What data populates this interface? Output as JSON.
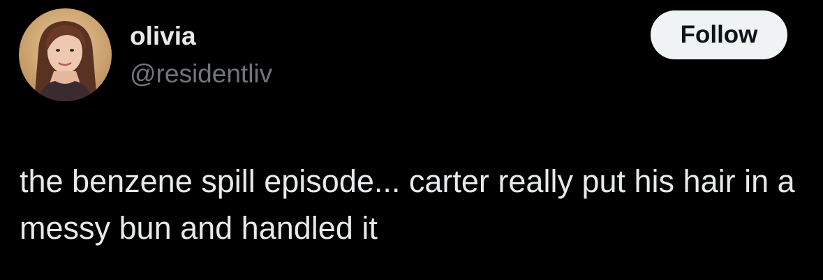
{
  "tweet": {
    "author": {
      "display_name": "olivia",
      "handle": "@residentliv",
      "avatar_icon": "profile-photo"
    },
    "follow_label": "Follow",
    "text": "the benzene spill episode... carter really put his hair in a messy bun and handled it"
  },
  "colors": {
    "background": "#000000",
    "primary_text": "#e7e9ea",
    "secondary_text": "#71767b",
    "follow_button_bg": "#eff3f4",
    "follow_button_text": "#0f1419"
  }
}
